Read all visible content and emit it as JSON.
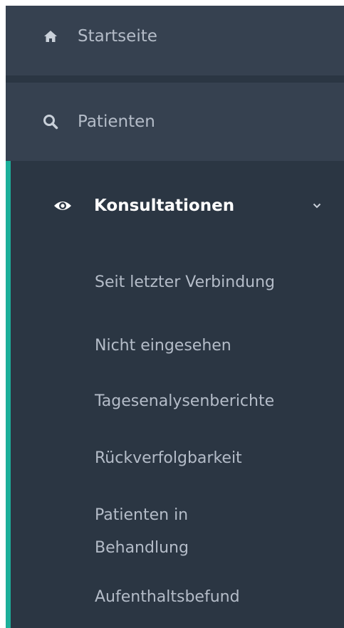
{
  "sidebar": {
    "items": [
      {
        "label": "Startseite",
        "icon": "home-icon"
      },
      {
        "label": "Patienten",
        "icon": "search-icon"
      }
    ],
    "section": {
      "label": "Konsultationen",
      "icon": "eye-icon",
      "expanded": true,
      "subitems": [
        {
          "label": "Seit letzter Verbindung"
        },
        {
          "label": "Nicht eingesehen"
        },
        {
          "label": "Tagesenalysenberichte"
        },
        {
          "label": "Rückverfolgbarkeit"
        },
        {
          "label": "Patienten in Behandlung"
        },
        {
          "label": "Aufenthaltsbefund"
        }
      ]
    }
  },
  "colors": {
    "sidebar_bg": "#2b3643",
    "top_item_bg": "#364150",
    "accent": "#1caf9a",
    "text_muted": "#b4bcc8",
    "text_active": "#ffffff"
  }
}
